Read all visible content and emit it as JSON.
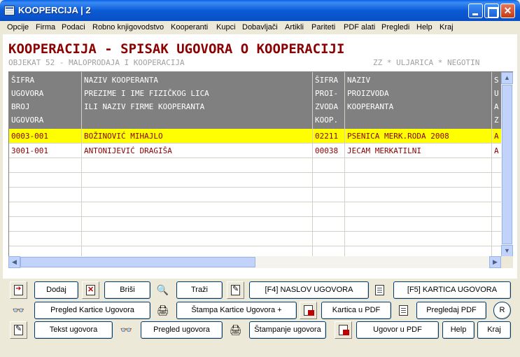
{
  "window": {
    "title": "KOOPERCIJA  |  2",
    "close_glyph": "✕"
  },
  "menu": [
    "Opcije",
    "Firma",
    "Podaci",
    "Robno knjigovodstvo",
    "Kooperanti",
    "Kupci",
    "Dobavljači",
    "Artikli",
    "Pariteti",
    "PDF alati",
    "Pregledi",
    "Help",
    "Kraj"
  ],
  "page": {
    "title": "KOOPERACIJA - SPISAK UGOVORA O KOOPERACIJI",
    "subtitle_left": "OBJEKAT  52 - MALOPRODAJA I KOOPERACIJA",
    "subtitle_right": "ZZ * ULJARICA * NEGOTIN"
  },
  "table": {
    "headers": [
      "ŠIFRA\nUGOVORA\nBROJ\nUGOVORA",
      "NAZIV KOOPERANTA\nPREZIME I IME FIZIČKOG LICA\nILI NAZIV FIRME KOOPERANTA",
      "ŠIFRA\nPROI-\nZVODA\nKOOP.",
      "NAZIV\nPROIZVODA\nKOOPERANTA",
      "S\nU\nA\nZ"
    ],
    "rows": [
      [
        "0003-001",
        "BOŽINOVIĆ MIHAJLO",
        "02211",
        "PSENICA MERK.RODA 2008",
        "A"
      ],
      [
        "3001-001",
        "ANTONIJEVIĆ DRAGIŠA",
        "00038",
        "JECAM MERKATILNI",
        "A"
      ]
    ],
    "selected_row": 0,
    "empty_rows": 7,
    "selected_color": "#ffff00",
    "text_color": "#8b0000",
    "header_bg": "#808080"
  },
  "buttons": {
    "dodaj": "Dodaj",
    "brisi": "Briši",
    "trazi": "Traži",
    "naslov": "[F4]    NASLOV UGOVORA",
    "kartica": "[F5]    KARTICA UGOVORA",
    "pregled_kartice": "Pregled Kartice Ugovora",
    "stampa_kartice": "Štampa Kartice Ugovora +",
    "kartica_pdf": "Kartica u PDF",
    "pregledaj_pdf": "Pregledaj PDF",
    "r_badge": "R",
    "tekst": "Tekst ugovora",
    "pregled_ugovora": "Pregled ugovora",
    "stampanje": "Štampanje ugovora",
    "ugovor_pdf": "Ugovor u PDF",
    "help": "Help",
    "kraj": "Kraj"
  },
  "icons": {
    "edit": "✎",
    "delete": "✕",
    "search": "🔍",
    "view": "👓",
    "print": "🖨",
    "pdf": "📄"
  }
}
